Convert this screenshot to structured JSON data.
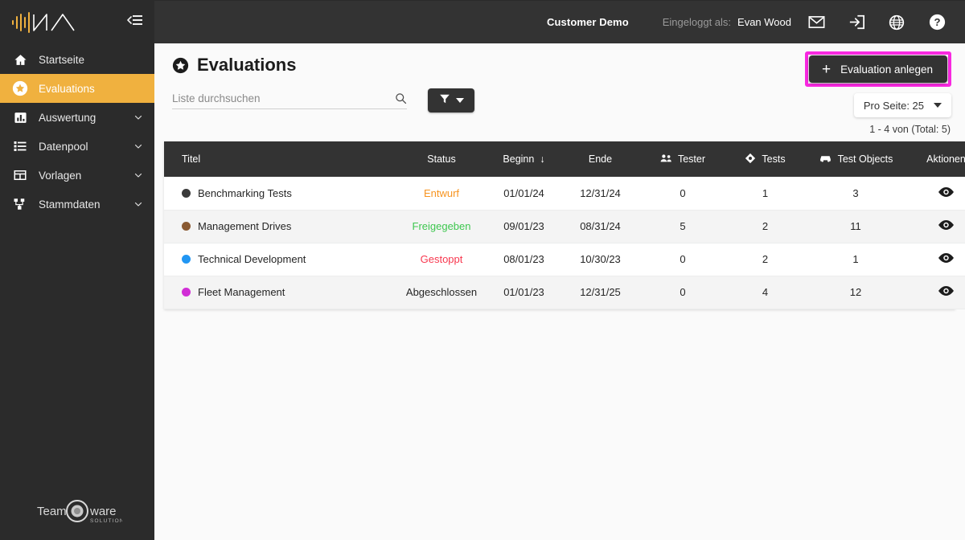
{
  "sidebar": {
    "logo": {
      "name": "app-logo",
      "text": ""
    },
    "collapse_icon": "collapse-sidebar-icon",
    "items": [
      {
        "label": "Startseite",
        "icon": "home-icon",
        "active": false,
        "expandable": false
      },
      {
        "label": "Evaluations",
        "icon": "star-icon",
        "active": true,
        "expandable": false
      },
      {
        "label": "Auswertung",
        "icon": "bar-chart-icon",
        "active": false,
        "expandable": true
      },
      {
        "label": "Datenpool",
        "icon": "list-rows-icon",
        "active": false,
        "expandable": true
      },
      {
        "label": "Vorlagen",
        "icon": "template-icon",
        "active": false,
        "expandable": true
      },
      {
        "label": "Stammdaten",
        "icon": "hierarchy-icon",
        "active": false,
        "expandable": true
      }
    ],
    "footer_logo": {
      "line1": "Team",
      "line2": "ware",
      "line3": "SOLUTIONS"
    }
  },
  "topbar": {
    "customer": "Customer Demo",
    "logged_in_label": "Eingeloggt als:",
    "user_name": "Evan Wood",
    "icons": [
      "mail-icon",
      "logout-icon",
      "globe-icon",
      "help-icon"
    ]
  },
  "page": {
    "title": "Evaluations",
    "title_icon": "star-badge-icon"
  },
  "search": {
    "placeholder": "Liste durchsuchen",
    "value": "",
    "icon": "search-icon"
  },
  "filter": {
    "icon": "funnel-icon",
    "label": ""
  },
  "actions": {
    "create_label": "Evaluation anlegen",
    "create_plus": "+",
    "per_page_label": "Pro Seite: 25"
  },
  "pagination": {
    "count_text": "1 - 4 von (Total: 5)"
  },
  "table": {
    "columns": [
      {
        "key": "title",
        "label": "Titel",
        "icon": null,
        "align": "left",
        "sorted": false
      },
      {
        "key": "status",
        "label": "Status",
        "icon": null,
        "align": "center",
        "sorted": false
      },
      {
        "key": "start",
        "label": "Beginn",
        "icon": null,
        "align": "center",
        "sorted": true,
        "sort_arrow": "↓"
      },
      {
        "key": "end",
        "label": "Ende",
        "icon": null,
        "align": "center",
        "sorted": false
      },
      {
        "key": "tester",
        "label": "Tester",
        "icon": "people-icon",
        "align": "center",
        "sorted": false
      },
      {
        "key": "tests",
        "label": "Tests",
        "icon": "diamond-icon",
        "align": "center",
        "sorted": false
      },
      {
        "key": "objects",
        "label": "Test Objects",
        "icon": "car-icon",
        "align": "center",
        "sorted": false
      },
      {
        "key": "actions",
        "label": "Aktionen",
        "icon": null,
        "align": "center",
        "sorted": false
      }
    ],
    "rows": [
      {
        "dot_color": "#3a3a3a",
        "title": "Benchmarking Tests",
        "status": "Entwurf",
        "status_class": "st-entwurf",
        "start": "01/01/24",
        "end": "12/31/24",
        "tester": "0",
        "tests": "1",
        "objects": "3",
        "action_icon": "eye-icon"
      },
      {
        "dot_color": "#8a5a32",
        "title": "Management Drives",
        "status": "Freigegeben",
        "status_class": "st-frei",
        "start": "09/01/23",
        "end": "08/31/24",
        "tester": "5",
        "tests": "2",
        "objects": "11",
        "action_icon": "eye-icon"
      },
      {
        "dot_color": "#2196f3",
        "title": "Technical Development",
        "status": "Gestoppt",
        "status_class": "st-stop",
        "start": "08/01/23",
        "end": "10/30/23",
        "tester": "0",
        "tests": "2",
        "objects": "1",
        "action_icon": "eye-icon"
      },
      {
        "dot_color": "#d12ed6",
        "title": "Fleet Management",
        "status": "Abgeschlossen",
        "status_class": "st-done",
        "start": "01/01/23",
        "end": "12/31/25",
        "tester": "0",
        "tests": "4",
        "objects": "12",
        "action_icon": "eye-icon"
      }
    ]
  },
  "colors": {
    "sidebar_bg": "#2b2b2b",
    "topbar_bg": "#333333",
    "accent": "#f0b13f",
    "highlight": "#f828e0",
    "content_bg": "#fafafa",
    "status_draft": "#f79420",
    "status_released": "#3ec74f",
    "status_stopped": "#f8384f"
  }
}
